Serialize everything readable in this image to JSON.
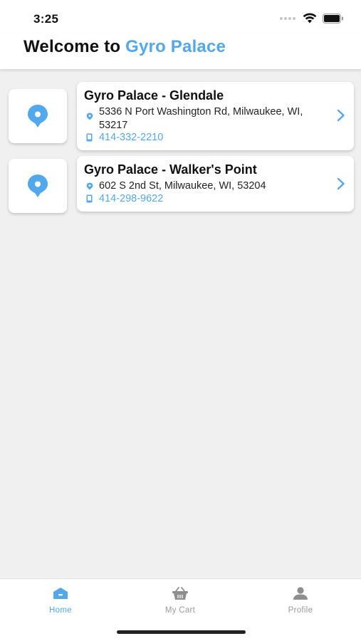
{
  "status_bar": {
    "time": "3:25"
  },
  "header": {
    "prefix": "Welcome to",
    "brand": "Gyro Palace"
  },
  "colors": {
    "accent": "#52a8ec",
    "background": "#f0f0f0",
    "inactive": "#9a9a9a"
  },
  "locations": [
    {
      "name": "Gyro Palace - Glendale",
      "address": "5336 N Port Washington Rd, Milwaukee, WI, 53217",
      "phone": "414-332-2210"
    },
    {
      "name": "Gyro Palace - Walker's Point",
      "address": "602 S 2nd St, Milwaukee, WI, 53204",
      "phone": "414-298-9622"
    }
  ],
  "tabs": [
    {
      "label": "Home",
      "icon": "home-icon",
      "active": true
    },
    {
      "label": "My Cart",
      "icon": "basket-icon",
      "active": false
    },
    {
      "label": "Profile",
      "icon": "person-icon",
      "active": false
    }
  ]
}
